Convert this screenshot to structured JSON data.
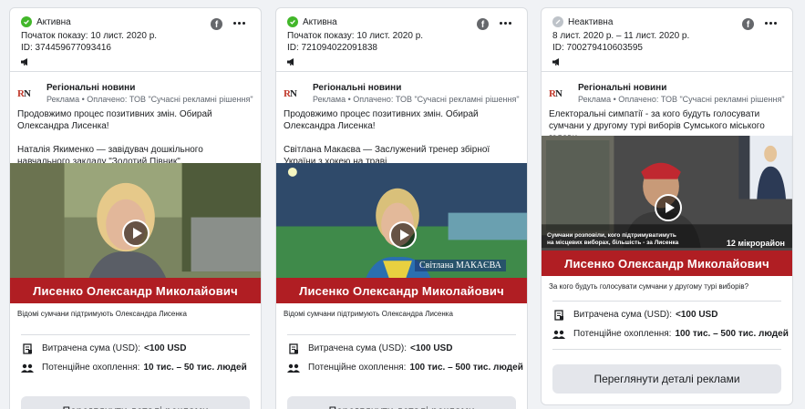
{
  "cards": [
    {
      "status": "Активна",
      "status_kind": "active",
      "start": "Початок показу: 10 лист. 2020 р.",
      "id": "ID: 374459677093416",
      "page_name": "Регіональні новини",
      "sponsor": "Реклама • Оплачено: ТОВ \"Сучасні рекламні рішення\"",
      "ad_text": "Продовжимо процес позитивних змін. Обирай Олександра Лисенка!\n\nНаталія Якименко — завідувач дошкільного навчального закладу \"Золотий Півник\".",
      "banner": "Лисенко Олександр Миколайович",
      "caption": "Відомі сумчани підтримують Олександра Лисенка",
      "spend_label": "Витрачена сума (USD):",
      "spend_value": "<100 USD",
      "reach_label": "Потенційне охоплення:",
      "reach_value": "10 тис. – 50 тис. людей",
      "button": "Переглянути деталі реклами"
    },
    {
      "status": "Активна",
      "status_kind": "active",
      "start": "Початок показу: 10 лист. 2020 р.",
      "id": "ID: 721094022091838",
      "page_name": "Регіональні новини",
      "sponsor": "Реклама • Оплачено: ТОВ \"Сучасні рекламні рішення\"",
      "ad_text": "Продовжимо процес позитивних змін. Обирай Олександра Лисенка!\n\nСвітлана Макаєва — Заслужений тренер збірної України з хокею на траві.",
      "banner": "Лисенко Олександр Миколайович",
      "overlay_name": "Світлана МАКАЄВА",
      "caption": "Відомі сумчани підтримують Олександра Лисенка",
      "spend_label": "Витрачена сума (USD):",
      "spend_value": "<100 USD",
      "reach_label": "Потенційне охоплення:",
      "reach_value": "100 тис. – 500 тис. людей",
      "button": "Переглянути деталі реклами"
    },
    {
      "status": "Неактивна",
      "status_kind": "inactive",
      "start": "8 лист. 2020 р. – 11 лист. 2020 р.",
      "id": "ID: 700279410603595",
      "page_name": "Регіональні новини",
      "sponsor": "Реклама • Оплачено: ТОВ \"Сучасні рекламні рішення\"",
      "ad_text": "Електоральні симпатії - за кого будуть голосувати сумчани у другому турі виборів Сумського міського голови.",
      "banner": "Лисенко Олександр Миколайович",
      "overlay_sub": "Сумчани розповіли, кого підтримуватимуть на місцевих виборах, більшість - за Лисенка",
      "overlay_badge": "12 мікрорайон",
      "caption": "За кого будуть голосувати сумчани у другому турі виборів?",
      "spend_label": "Витрачена сума (USD):",
      "spend_value": "<100 USD",
      "reach_label": "Потенційне охоплення:",
      "reach_value": "100 тис. – 500 тис. людей",
      "button": "Переглянути деталі реклами"
    }
  ],
  "colors": {
    "active": "#42b72a",
    "inactive": "#bec3c9",
    "banner": "#b01e23"
  }
}
